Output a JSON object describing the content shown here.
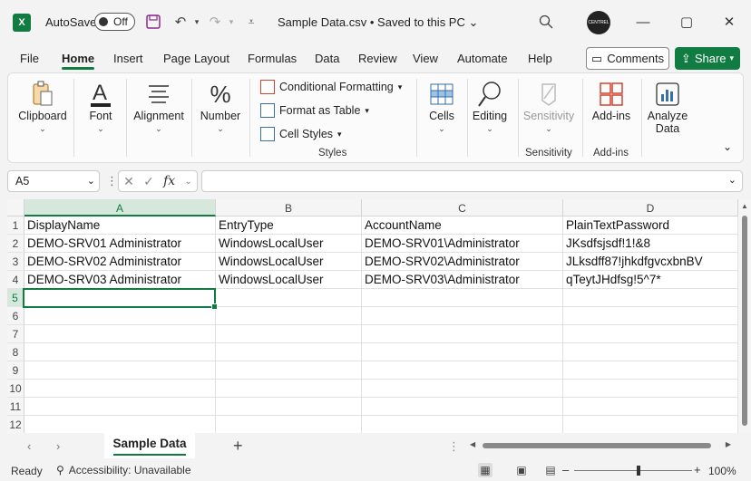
{
  "titlebar": {
    "app_logo": "X",
    "autosave_label": "AutoSave",
    "autosave_state": "Off",
    "document_title": "Sample Data.csv • Saved to this PC",
    "avatar_text": "CENTREL"
  },
  "menu": {
    "tabs": [
      "File",
      "Home",
      "Insert",
      "Page Layout",
      "Formulas",
      "Data",
      "Review",
      "View",
      "Automate",
      "Help"
    ],
    "active": "Home",
    "comments_label": "Comments",
    "share_label": "Share"
  },
  "ribbon": {
    "clipboard": "Clipboard",
    "font": "Font",
    "alignment": "Alignment",
    "number": "Number",
    "conditional_formatting": "Conditional Formatting",
    "format_as_table": "Format as Table",
    "cell_styles": "Cell Styles",
    "styles_group": "Styles",
    "cells": "Cells",
    "editing": "Editing",
    "sensitivity_btn": "Sensitivity",
    "sensitivity_group": "Sensitivity",
    "addins_btn": "Add-ins",
    "addins_group": "Add-ins",
    "analyze_line1": "Analyze",
    "analyze_line2": "Data"
  },
  "formula_bar": {
    "name_box": "A5",
    "fx": "fx",
    "value": ""
  },
  "sheet": {
    "columns": [
      "A",
      "B",
      "C",
      "D"
    ],
    "rows": [
      "1",
      "2",
      "3",
      "4",
      "5",
      "6",
      "7",
      "8",
      "9",
      "10",
      "11",
      "12"
    ],
    "cells": [
      [
        "DisplayName",
        "EntryType",
        "AccountName",
        "PlainTextPassword"
      ],
      [
        "DEMO-SRV01 Administrator",
        "WindowsLocalUser",
        "DEMO-SRV01\\Administrator",
        "JKsdfsjsdf!1!&8"
      ],
      [
        "DEMO-SRV02 Administrator",
        "WindowsLocalUser",
        "DEMO-SRV02\\Administrator",
        "JLksdff87!jhkdfgvcxbnBV"
      ],
      [
        "DEMO-SRV03 Administrator",
        "WindowsLocalUser",
        "DEMO-SRV03\\Administrator",
        "qTeytJHdfsg!5^7*"
      ]
    ],
    "active_cell": "A5",
    "tab_name": "Sample Data"
  },
  "status": {
    "ready": "Ready",
    "accessibility": "Accessibility: Unavailable",
    "zoom": "100%"
  },
  "colors": {
    "accent": "#107c41"
  }
}
